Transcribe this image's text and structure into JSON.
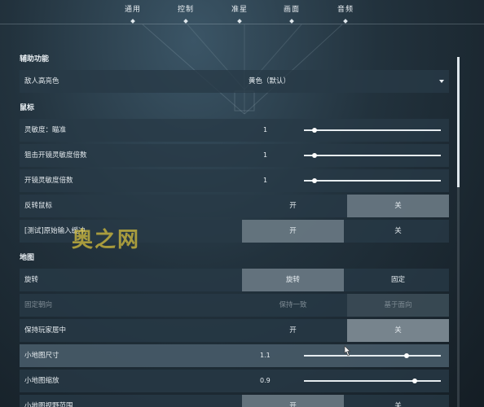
{
  "tabs": [
    {
      "label": "通用"
    },
    {
      "label": "控制"
    },
    {
      "label": "准星"
    },
    {
      "label": "画面"
    },
    {
      "label": "音频"
    }
  ],
  "sections": {
    "assist": {
      "title": "辅助功能",
      "enemy_highlight": {
        "label": "敌人高亮色",
        "value": "黄色（默认）"
      }
    },
    "mouse": {
      "title": "鼠标",
      "sensitivity_aim": {
        "label": "灵敏度：瞄准",
        "value": "1",
        "fraction": 0.08
      },
      "sniper_scope": {
        "label": "狙击开镜灵敏度倍数",
        "value": "1",
        "fraction": 0.08
      },
      "scope_sens": {
        "label": "开镜灵敏度倍数",
        "value": "1",
        "fraction": 0.08
      },
      "invert_mouse": {
        "label": "反转鼠标",
        "on": "开",
        "off": "关",
        "selected": "off"
      },
      "raw_input": {
        "label": "[测试]原始输入缓冲",
        "on": "开",
        "off": "关",
        "selected": "on"
      }
    },
    "map": {
      "title": "地图",
      "rotate": {
        "label": "旋转",
        "on": "旋转",
        "off": "固定",
        "selected": "on"
      },
      "fixed_orientation": {
        "label": "固定朝向",
        "on": "保持一致",
        "off": "基于面向",
        "selected": "off"
      },
      "keep_player_center": {
        "label": "保持玩家居中",
        "on": "开",
        "off": "关",
        "selected": "off"
      },
      "minimap_size": {
        "label": "小地图尺寸",
        "value": "1.1",
        "fraction": 0.75
      },
      "minimap_zoom": {
        "label": "小地图缩放",
        "value": "0.9",
        "fraction": 0.81
      },
      "minimap_vision": {
        "label": "小地图视野范围",
        "on": "开",
        "off": "关",
        "selected": "on"
      }
    }
  },
  "watermark": "奥之网",
  "colors": {
    "background": "#1c2a33",
    "row": "#283a46",
    "active": "#7a8790",
    "watermark": "#d4be3c"
  }
}
